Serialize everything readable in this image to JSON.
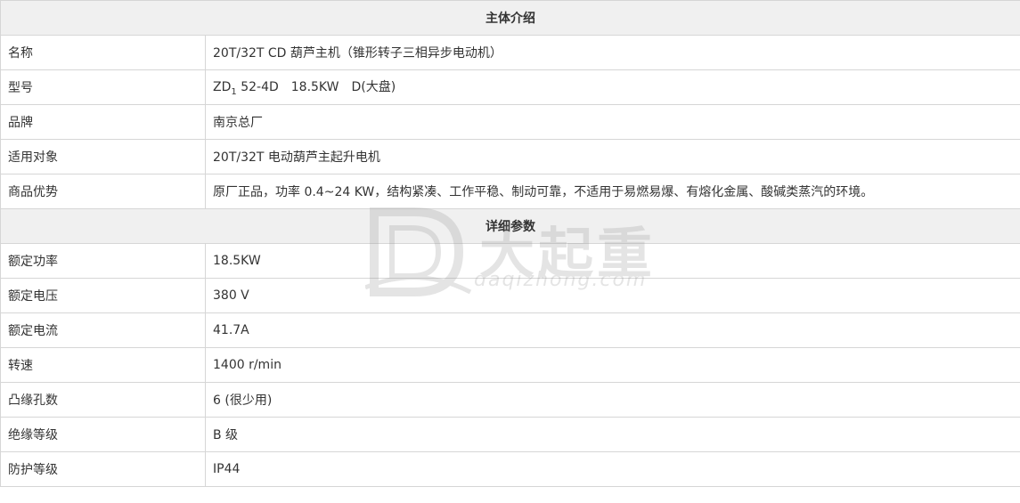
{
  "sections": {
    "intro_title": "主体介绍",
    "params_title": "详细参数"
  },
  "intro": [
    {
      "label": "名称",
      "value": "20T/32T CD 葫芦主机（锥形转子三相异步电动机）"
    },
    {
      "label": "型号",
      "value_main": "ZD",
      "value_sub": "1",
      "value_rest": " 52-4D　18.5KW　D(大盘)"
    },
    {
      "label": "品牌",
      "value": "南京总厂"
    },
    {
      "label": "适用对象",
      "value": "20T/32T 电动葫芦主起升电机"
    },
    {
      "label": "商品优势",
      "value": "原厂正品，功率 0.4~24 KW，结构紧凑、工作平稳、制动可靠，不适用于易燃易爆、有熔化金属、酸碱类蒸汽的环境。"
    }
  ],
  "params": [
    {
      "label": "额定功率",
      "value": "18.5KW"
    },
    {
      "label": "额定电压",
      "value": "380 V"
    },
    {
      "label": "额定电流",
      "value": "41.7A"
    },
    {
      "label": "转速",
      "value": "1400 r/min"
    },
    {
      "label": "凸缘孔数",
      "value": "6 (很少用)"
    },
    {
      "label": "绝缘等级",
      "value": "B 级"
    },
    {
      "label": "防护等级",
      "value": "IP44"
    }
  ],
  "watermark": {
    "brand_cn": "大起重",
    "domain": "daqizhong.com"
  },
  "colors": {
    "section_bg": "#f0f0f0",
    "border": "#d6d6d6",
    "text": "#333333"
  }
}
